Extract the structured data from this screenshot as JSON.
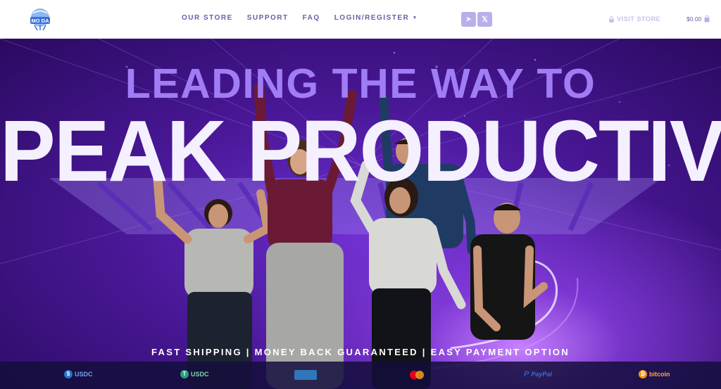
{
  "logo": {
    "text": "MO DA"
  },
  "nav": {
    "items": [
      {
        "label": "OUR STORE"
      },
      {
        "label": "SUPPORT"
      },
      {
        "label": "FAQ"
      },
      {
        "label": "LOGIN/REGISTER"
      }
    ],
    "login_caret": "▾"
  },
  "social": {
    "telegram_icon": "➤",
    "x_icon": "𝕏"
  },
  "visit_store": {
    "label": "VISIT STORE",
    "icon": "lock-icon"
  },
  "cart": {
    "amount": "$0.00",
    "icon": "bag-icon"
  },
  "hero": {
    "headline_line1": "LEADING THE WAY TO",
    "headline_line2": "PEAK PRODUCTIVITY",
    "tagline": "FAST SHIPPING | MONEY BACK GUARANTEED | EASY PAYMENT OPTION"
  },
  "payments": [
    {
      "label": "USDC",
      "color": "#2775ca"
    },
    {
      "label": "USDC",
      "color": "#26a17b"
    },
    {
      "label": "",
      "color": "#2e77bc"
    },
    {
      "label": "",
      "color": "#eb001b"
    },
    {
      "label": "PayPal",
      "color": "#253b80"
    },
    {
      "label": "bitcoin",
      "color": "#f7931a"
    }
  ],
  "colors": {
    "accent": "#6b5ea8",
    "hero_purple": "#4a1898",
    "headline": "#a07cf5"
  }
}
